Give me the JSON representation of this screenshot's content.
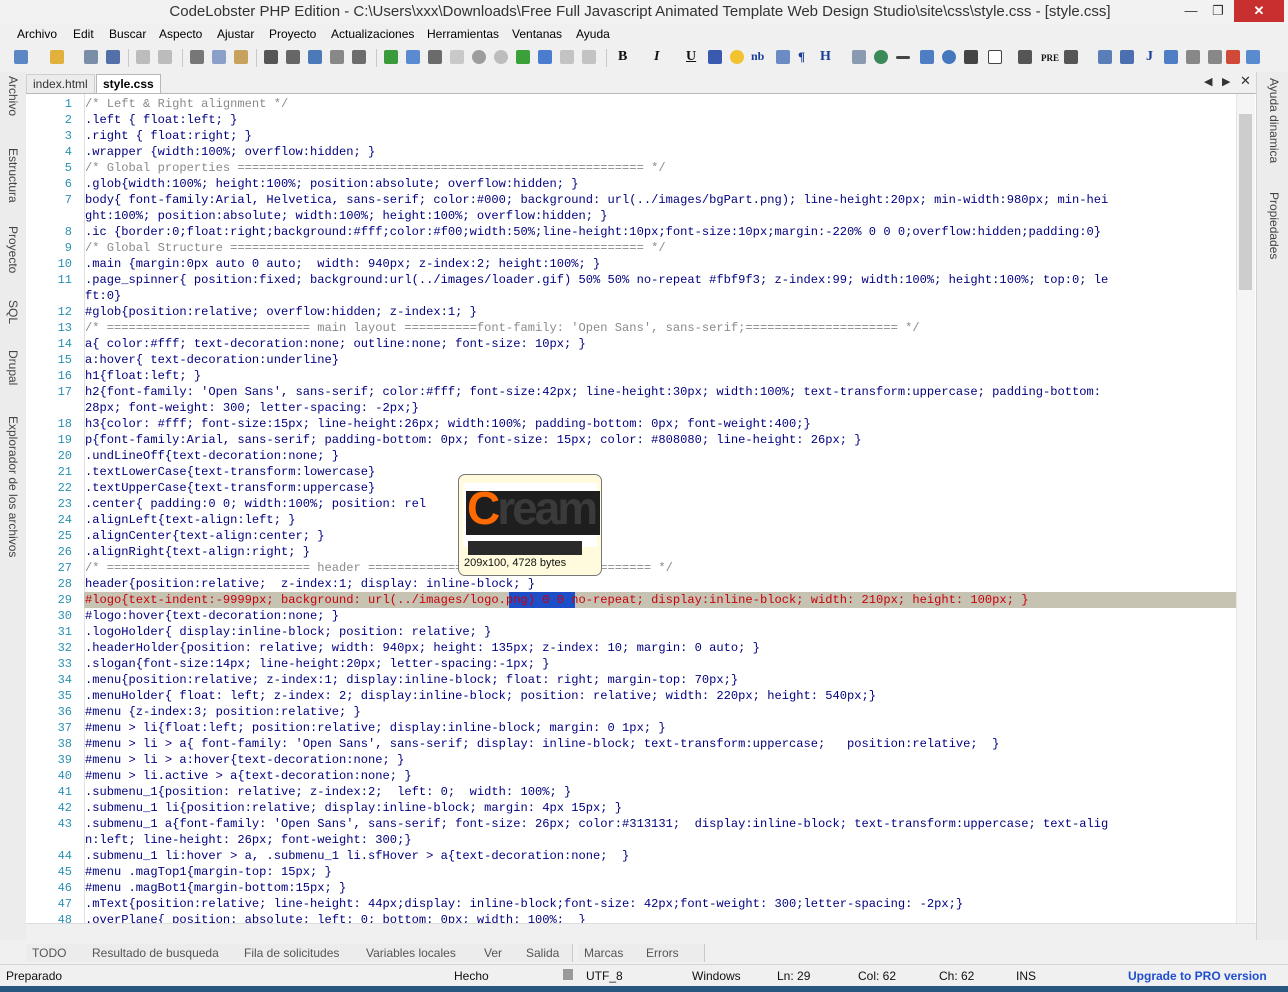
{
  "window": {
    "title": "CodeLobster PHP Edition - C:\\Users\\xxx\\Downloads\\Free Full Javascript Animated Template Web Design Studio\\site\\css\\style.css - [style.css]",
    "min_glyph": "—",
    "max_glyph": "❐",
    "close_glyph": "✕"
  },
  "menu": [
    "Archivo",
    "Edit",
    "Buscar",
    "Aspecto",
    "Ajustar",
    "Proyecto",
    "Actualizaciones",
    "Herramientas",
    "Ventanas",
    "Ayuda"
  ],
  "toolbar": {
    "bold": "B",
    "italic": "I",
    "underline": "U",
    "nb": "nb",
    "para": "¶",
    "heading": "H",
    "pre": "PRE",
    "j": "J"
  },
  "left_panel": [
    "Archivo",
    "Estructura",
    "Proyecto",
    "SQL",
    "Drupal",
    "Explorador de los archivos"
  ],
  "right_panel": [
    "Ayuda dinamica",
    "Propiedades"
  ],
  "tabs": {
    "index": "index.html",
    "style": "style.css",
    "prev": "◀",
    "next": "▶",
    "close": "✕"
  },
  "editor": {
    "lines": [
      {
        "n": "1",
        "t": "/* Left & Right alignment */"
      },
      {
        "n": "2",
        "t": ".left { float:left; }"
      },
      {
        "n": "3",
        "t": ".right { float:right; }"
      },
      {
        "n": "4",
        "t": ".wrapper {width:100%; overflow:hidden; }"
      },
      {
        "n": "5",
        "t": "/* Global properties ======================================================== */"
      },
      {
        "n": "6",
        "t": ".glob{width:100%; height:100%; position:absolute; overflow:hidden; }"
      },
      {
        "n": "7",
        "t": "body{ font-family:Arial, Helvetica, sans-serif; color:#000; background: url(../images/bgPart.png); line-height:20px; min-width:980px; min-hei"
      },
      {
        "n": "",
        "t": "ght:100%; position:absolute; width:100%; height:100%; overflow:hidden; }"
      },
      {
        "n": "8",
        "t": ".ic {border:0;float:right;background:#fff;color:#f00;width:50%;line-height:10px;font-size:10px;margin:-220% 0 0 0;overflow:hidden;padding:0}"
      },
      {
        "n": "9",
        "t": "/* Global Structure ========================================================= */"
      },
      {
        "n": "10",
        "t": ".main {margin:0px auto 0 auto;  width: 940px; z-index:2; height:100%; }"
      },
      {
        "n": "11",
        "t": ".page_spinner{ position:fixed; background:url(../images/loader.gif) 50% 50% no-repeat #fbf9f3; z-index:99; width:100%; height:100%; top:0; le"
      },
      {
        "n": "",
        "t": "ft:0}"
      },
      {
        "n": "12",
        "t": "#glob{position:relative; overflow:hidden; z-index:1; }"
      },
      {
        "n": "13",
        "t": "/* ============================ main layout ==========font-family: 'Open Sans', sans-serif;===================== */"
      },
      {
        "n": "14",
        "t": "a{ color:#fff; text-decoration:none; outline:none; font-size: 10px; }"
      },
      {
        "n": "15",
        "t": "a:hover{ text-decoration:underline}"
      },
      {
        "n": "16",
        "t": "h1{float:left; }"
      },
      {
        "n": "17",
        "t": "h2{font-family: 'Open Sans', sans-serif; color:#fff; font-size:42px; line-height:30px; width:100%; text-transform:uppercase; padding-bottom:"
      },
      {
        "n": "",
        "t": "28px; font-weight: 300; letter-spacing: -2px;}"
      },
      {
        "n": "18",
        "t": "h3{color: #fff; font-size:15px; line-height:26px; width:100%; padding-bottom: 0px; font-weight:400;}"
      },
      {
        "n": "19",
        "t": "p{font-family:Arial, sans-serif; padding-bottom: 0px; font-size: 15px; color: #808080; line-height: 26px; }"
      },
      {
        "n": "20",
        "t": ".undLineOff{text-decoration:none; }"
      },
      {
        "n": "21",
        "t": ".textLowerCase{text-transform:lowercase}"
      },
      {
        "n": "22",
        "t": ".textUpperCase{text-transform:uppercase}"
      },
      {
        "n": "23",
        "t": ".center{ padding:0 0; width:100%; position: rel"
      },
      {
        "n": "24",
        "t": ".alignLeft{text-align:left; }"
      },
      {
        "n": "25",
        "t": ".alignCenter{text-align:center; }"
      },
      {
        "n": "26",
        "t": ".alignRight{text-align:right; }"
      },
      {
        "n": "27",
        "t": "/* ============================ header ======================================= */"
      },
      {
        "n": "28",
        "t": "header{position:relative;  z-index:1; display: inline-block; }"
      },
      {
        "n": "29",
        "t": "#logo{text-indent:-9999px; background: url(../images/logo.png) 0 0 no-repeat; display:inline-block; width: 210px; height: 100px; }"
      },
      {
        "n": "30",
        "t": "#logo:hover{text-decoration:none; }"
      },
      {
        "n": "31",
        "t": ".logoHolder{ display:inline-block; position: relative; }"
      },
      {
        "n": "32",
        "t": ".headerHolder{position: relative; width: 940px; height: 135px; z-index: 10; margin: 0 auto; }"
      },
      {
        "n": "33",
        "t": ".slogan{font-size:14px; line-height:20px; letter-spacing:-1px; }"
      },
      {
        "n": "34",
        "t": ".menu{position:relative; z-index:1; display:inline-block; float: right; margin-top: 70px;}"
      },
      {
        "n": "35",
        "t": ".menuHolder{ float: left; z-index: 2; display:inline-block; position: relative; width: 220px; height: 540px;}"
      },
      {
        "n": "36",
        "t": "#menu {z-index:3; position:relative; }"
      },
      {
        "n": "37",
        "t": "#menu > li{float:left; position:relative; display:inline-block; margin: 0 1px; }"
      },
      {
        "n": "38",
        "t": "#menu > li > a{ font-family: 'Open Sans', sans-serif; display: inline-block; text-transform:uppercase;   position:relative;  }"
      },
      {
        "n": "39",
        "t": "#menu > li > a:hover{text-decoration:none; }"
      },
      {
        "n": "40",
        "t": "#menu > li.active > a{text-decoration:none; }"
      },
      {
        "n": "41",
        "t": ".submenu_1{position: relative; z-index:2;  left: 0;  width: 100%; }"
      },
      {
        "n": "42",
        "t": ".submenu_1 li{position:relative; display:inline-block; margin: 4px 15px; }"
      },
      {
        "n": "43",
        "t": ".submenu_1 a{font-family: 'Open Sans', sans-serif; font-size: 26px; color:#313131;  display:inline-block; text-transform:uppercase; text-alig"
      },
      {
        "n": "",
        "t": "n:left; line-height: 26px; font-weight: 300;}"
      },
      {
        "n": "44",
        "t": ".submenu_1 li:hover > a, .submenu_1 li.sfHover > a{text-decoration:none;  }"
      },
      {
        "n": "45",
        "t": "#menu .magTop1{margin-top: 15px; }"
      },
      {
        "n": "46",
        "t": "#menu .magBot1{margin-bottom:15px; }"
      },
      {
        "n": "47",
        "t": ".mText{position:relative; line-height: 44px;display: inline-block;font-size: 42px;font-weight: 300;letter-spacing: -2px;}"
      },
      {
        "n": "48",
        "t": ".overPlane{ position: absolute; left: 0; bottom: 0px; width: 100%;  }"
      }
    ]
  },
  "tooltip": {
    "logo_text": "ream",
    "logo_c": "C",
    "size": "209x100, 4728 bytes"
  },
  "bottom_tabs": [
    "TODO",
    "Resultado de busqueda",
    "Fila de solicitudes",
    "Variables locales",
    "Ver",
    "Salida",
    "Marcas",
    "Errors"
  ],
  "status": {
    "ready": "Preparado",
    "done": "Hecho",
    "encoding": "UTF_8",
    "eol": "Windows",
    "line": "Ln: 29",
    "col": "Col: 62",
    "ch": "Ch: 62",
    "mode": "INS",
    "upgrade": "Upgrade to PRO version"
  }
}
